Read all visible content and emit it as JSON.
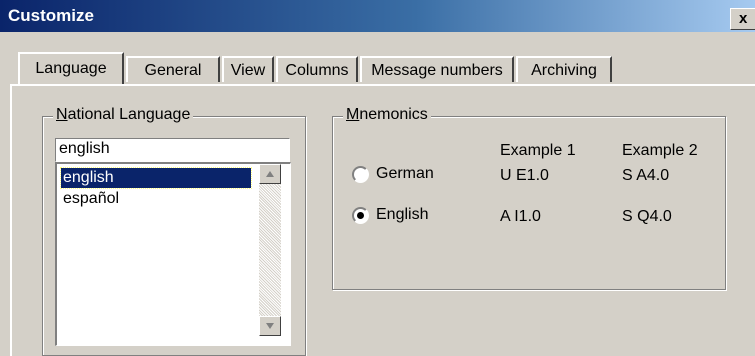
{
  "window": {
    "title": "Customize",
    "close_glyph": "x"
  },
  "tabs": [
    {
      "label": "Language",
      "active": true
    },
    {
      "label": "General",
      "active": false
    },
    {
      "label": "View",
      "active": false
    },
    {
      "label": "Columns",
      "active": false
    },
    {
      "label": "Message numbers",
      "active": false
    },
    {
      "label": "Archiving",
      "active": false
    }
  ],
  "national_language": {
    "label_first": "N",
    "label_rest": "ational Language",
    "combo_value": "english",
    "items": [
      {
        "label": "english",
        "selected": true
      },
      {
        "label": "español",
        "selected": false
      }
    ]
  },
  "mnemonics": {
    "label_first": "M",
    "label_rest": "nemonics",
    "headers": [
      "Example 1",
      "Example 2"
    ],
    "options": [
      {
        "label": "German",
        "selected": false,
        "example1": "U E1.0",
        "example2": "S A4.0"
      },
      {
        "label": "English",
        "selected": true,
        "example1": "A I1.0",
        "example2": "S Q4.0"
      }
    ]
  },
  "icons": {
    "scroll_up": "triangle-up-icon",
    "scroll_down": "triangle-down-icon"
  }
}
